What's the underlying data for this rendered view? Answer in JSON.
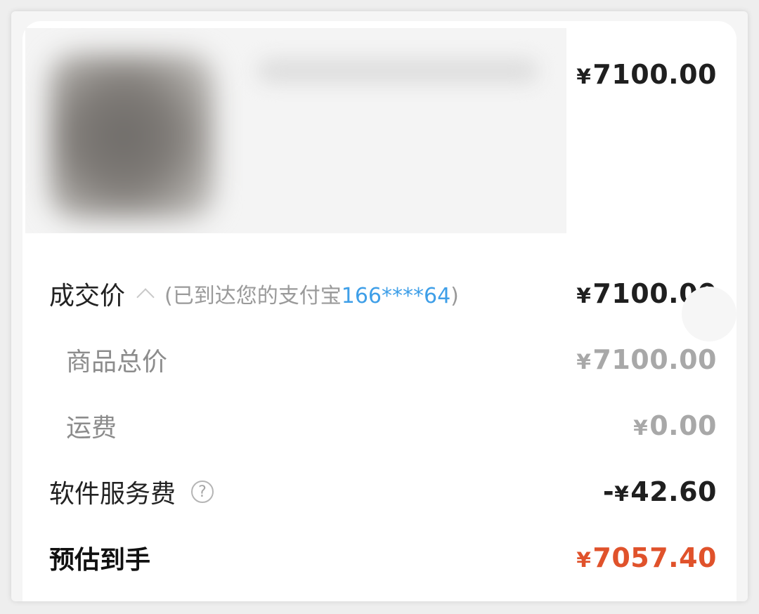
{
  "product": {
    "price": "7100.00",
    "currency": "¥"
  },
  "deal_price": {
    "label": "成交价",
    "note_prefix": "(已到达您的支付宝",
    "account": "166****64",
    "note_suffix": ")",
    "amount": "7100.00"
  },
  "goods_total": {
    "label": "商品总价",
    "amount": "7100.00"
  },
  "shipping": {
    "label": "运费",
    "amount": "0.00"
  },
  "service_fee": {
    "label": "软件服务费",
    "sign": "-",
    "amount": "42.60"
  },
  "estimated": {
    "label": "预估到手",
    "amount": "7057.40"
  },
  "colors": {
    "accent_red": "#e0522b",
    "link_blue": "#3f9fe8"
  }
}
